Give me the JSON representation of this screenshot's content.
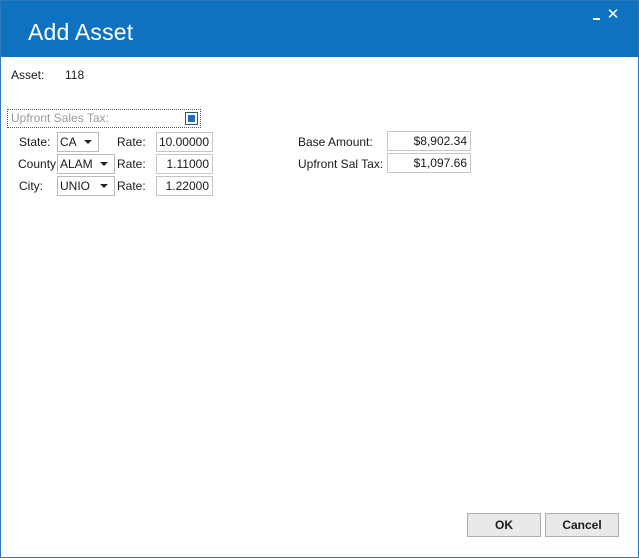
{
  "window": {
    "title": "Add Asset",
    "minimize_glyph": "_",
    "close_glyph": "✕"
  },
  "asset": {
    "label": "Asset:",
    "value": "118"
  },
  "upfront_sales_tax": {
    "label": "Upfront Sales Tax:",
    "checked": true
  },
  "tax_rows": [
    {
      "label": "State:",
      "selected": "CA",
      "rate_label": "Rate:",
      "rate": "10.00000"
    },
    {
      "label": "County:",
      "selected": "ALAM",
      "rate_label": "Rate:",
      "rate": "1.11000"
    },
    {
      "label": "City:",
      "selected": "UNIO",
      "rate_label": "Rate:",
      "rate": "1.22000"
    }
  ],
  "amounts": {
    "base_label": "Base Amount:",
    "base_value": "$8,902.34",
    "upfront_label": "Upfront Sal Tax:",
    "upfront_value": "$1,097.66"
  },
  "buttons": {
    "ok": "OK",
    "cancel": "Cancel"
  },
  "colors": {
    "titlebar": "#0f72c1",
    "checkbox_fill": "#1c6fc0"
  }
}
